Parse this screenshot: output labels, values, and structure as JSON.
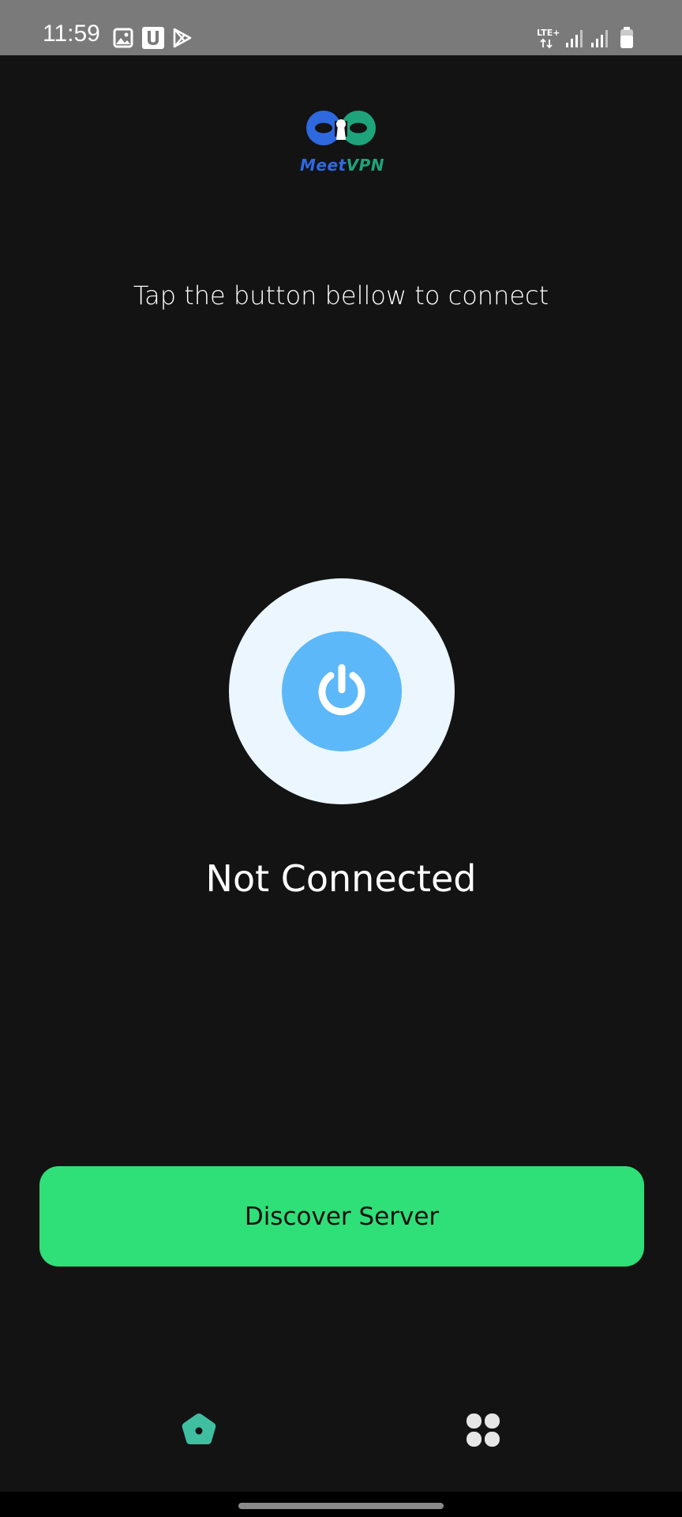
{
  "status_bar": {
    "time": "11:59",
    "left_icons": [
      "image-icon",
      "u-app-icon",
      "play-store-icon"
    ],
    "network": "LTE+",
    "right_icons": [
      "lte-icon",
      "signal-icon",
      "signal-icon-2",
      "battery-icon"
    ]
  },
  "logo": {
    "brand_part1": "Meet",
    "brand_part2": "VPN",
    "colors": {
      "blue": "#2f69e0",
      "green": "#1fa37a"
    }
  },
  "main": {
    "subtitle": "Tap the button bellow to connect",
    "power_button_icon": "power-icon",
    "status": "Not Connected",
    "discover_button": "Discover Server"
  },
  "colors": {
    "background": "#131313",
    "accent_green": "#2fdf78",
    "power_outer": "#ebf6fe",
    "power_inner": "#5cb8f8",
    "nav_active": "#3fbfa0",
    "nav_inactive": "#e6e6e6"
  },
  "nav": {
    "items": [
      {
        "icon": "home-icon",
        "active": true
      },
      {
        "icon": "apps-grid-icon",
        "active": false
      }
    ]
  }
}
